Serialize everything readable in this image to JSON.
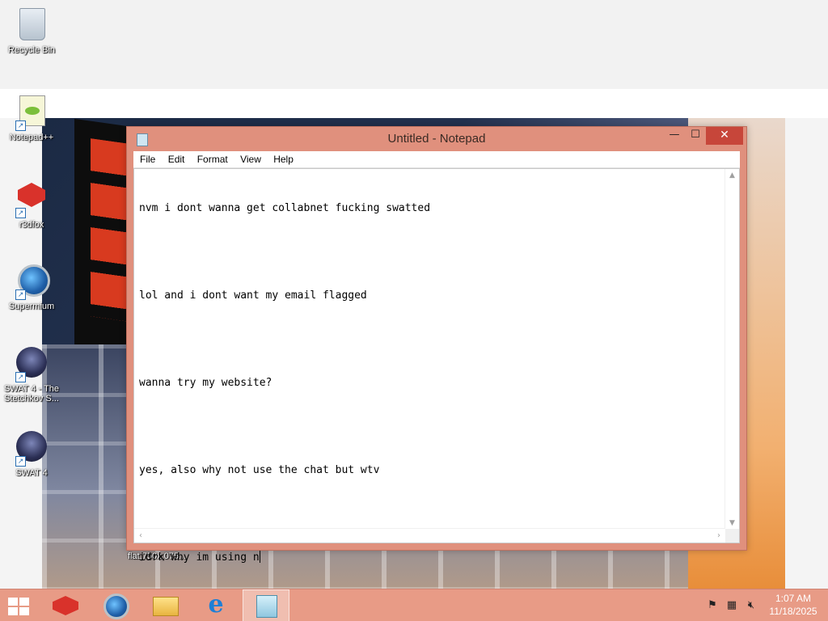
{
  "desktop": {
    "icons": [
      {
        "label": "Recycle Bin",
        "icon": "recycle-bin-icon"
      },
      {
        "label": "Notepad++",
        "icon": "notepad-plus-plus-icon"
      },
      {
        "label": "r3dfox",
        "icon": "r3dfox-icon"
      },
      {
        "label": "Supermium",
        "icon": "supermium-icon"
      },
      {
        "label": "SWAT 4 - The Stetchkov S...",
        "icon": "swat4-stetchkov-icon"
      },
      {
        "label": "SWAT 4",
        "icon": "swat4-icon"
      }
    ],
    "hover_filename": "flat,750x,075..."
  },
  "notepad": {
    "title": "Untitled - Notepad",
    "menu": [
      "File",
      "Edit",
      "Format",
      "View",
      "Help"
    ],
    "lines": [
      "nvm i dont wanna get collabnet fucking swatted",
      "",
      "lol and i dont want my email flagged",
      "",
      "wanna try my website?",
      "",
      "yes, also why not use the chat but wtv",
      "",
      "idrk why im using n"
    ],
    "buttons": {
      "minimize": "—",
      "maximize": "☐",
      "close": "✕"
    }
  },
  "taskbar": {
    "apps": [
      "r3dfox",
      "Supermium",
      "File Explorer",
      "Internet Explorer",
      "Notepad"
    ],
    "active_app": "Notepad",
    "tray_icons": [
      "action-center-flag-icon",
      "network-icon",
      "volume-muted-icon"
    ],
    "clock": {
      "time": "1:07 AM",
      "date": "11/18/2025"
    }
  },
  "colors": {
    "accent": "#e89b86",
    "window_frame": "#e0907d",
    "close_button": "#c7463a"
  }
}
